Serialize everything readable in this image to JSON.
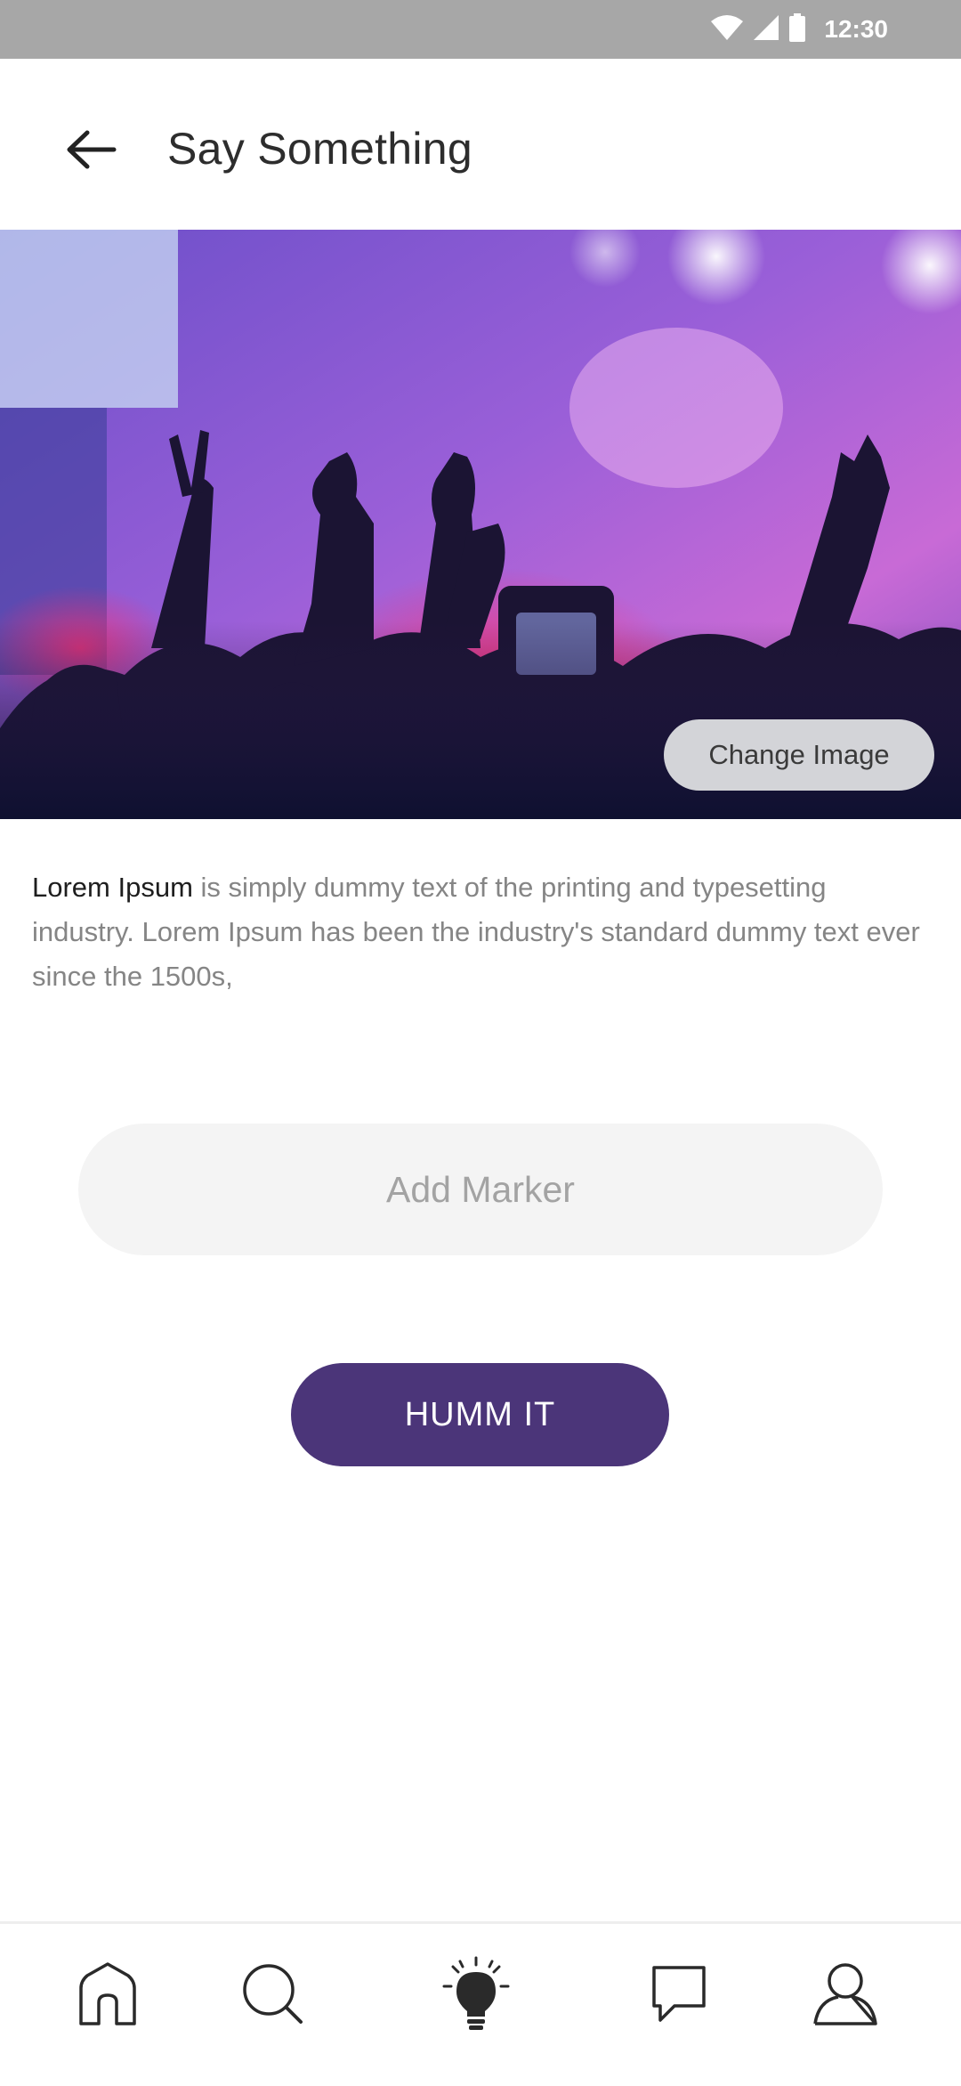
{
  "status_bar": {
    "time": "12:30"
  },
  "header": {
    "title": "Say Something",
    "back_icon": "arrow-left-icon"
  },
  "hero": {
    "change_image_label": "Change Image"
  },
  "description": {
    "lead": "Lorem Ipsum",
    "body": " is simply dummy text of the printing and typesetting industry. Lorem Ipsum has been the industry's standard dummy text ever since the 1500s,"
  },
  "marker": {
    "placeholder": "Add Marker"
  },
  "actions": {
    "humm_label": "HUMM IT"
  },
  "bottom_nav": {
    "items": [
      {
        "icon": "home-icon"
      },
      {
        "icon": "search-icon"
      },
      {
        "icon": "lightbulb-icon"
      },
      {
        "icon": "chat-icon"
      },
      {
        "icon": "profile-icon"
      }
    ]
  },
  "colors": {
    "status_bar": "#a7a7a7",
    "primary_button": "#4b3579",
    "marker_field": "#f4f4f4",
    "change_image_button": "#d3d4d8"
  }
}
